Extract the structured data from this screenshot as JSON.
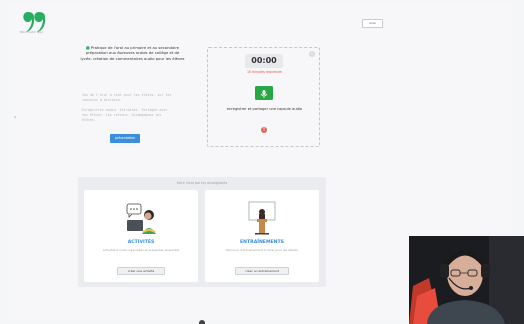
{
  "header": {
    "logo_text": "Mon outil Ipsi",
    "top_button_label": "Aide"
  },
  "intro": {
    "text": "Pratique de l'oral au primaire et au secondaire préparation aux épreuves orales de collège et de lycée. création de commentaires audio pour les élèves",
    "muted_1": "Vos de l'oral à tout pour les élèves, sur les capsules à distance.",
    "muted_2": "Enregistrez audio. Entraînez. Partagez avec vos élèves. Les retours. Accompagnez vos élèves.",
    "present_button_label": "présentation"
  },
  "recorder": {
    "timer": "00:00",
    "limit_text": "10 minutes maximum",
    "record_text": "enregistrer et partager une capsule audio",
    "close_icon": "x-icon",
    "mic_icon": "microphone-icon",
    "warning_icon": "warning-icon"
  },
  "panel": {
    "title": "Faire l'oral par les enseignants",
    "cards": [
      {
        "title": "ACTIVITÉS",
        "desc": "Activités d'orals organisées et préparées ensemble",
        "button_label": "créer une activité"
      },
      {
        "title": "ENTRAÎNEMENTS",
        "desc": "Parcours d'entraînement à l'oral pour les élèves",
        "button_label": "créer un entraînement"
      }
    ]
  },
  "colors": {
    "accent_blue": "#3a8edc",
    "accent_green": "#28a745",
    "logo_green": "#27ae60",
    "warn_red": "#e74c3c"
  }
}
